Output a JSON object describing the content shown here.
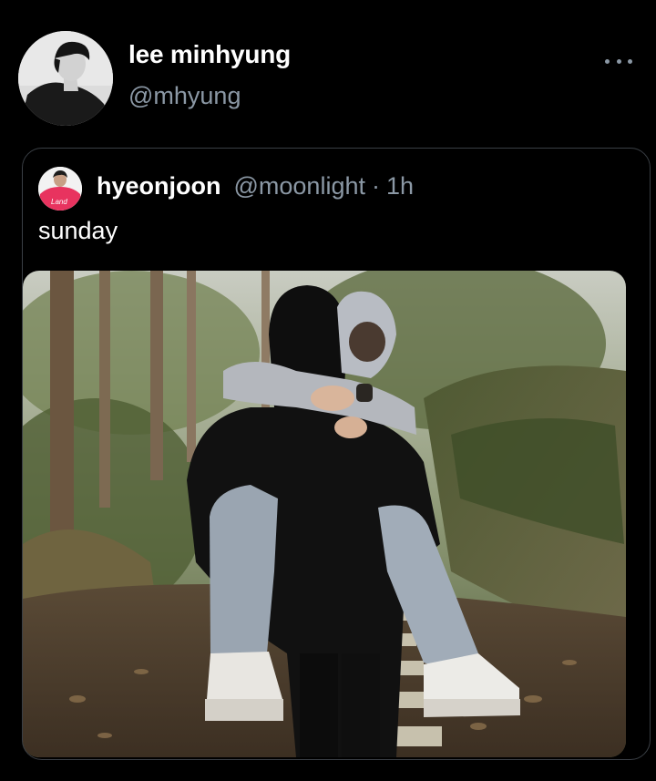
{
  "post": {
    "author_name": "lee minhyung",
    "author_handle": "@mhyung",
    "more_icon": "more-horizontal-icon"
  },
  "quoted": {
    "name": "hyeonjoon",
    "handle": "@moonlight",
    "separator": "·",
    "time": "1h",
    "text": "sunday",
    "avatar_jersey_text": "Land"
  },
  "colors": {
    "background": "#000000",
    "primary_text": "#ffffff",
    "secondary_text": "#8b98a5",
    "card_border": "#3a3f45"
  }
}
